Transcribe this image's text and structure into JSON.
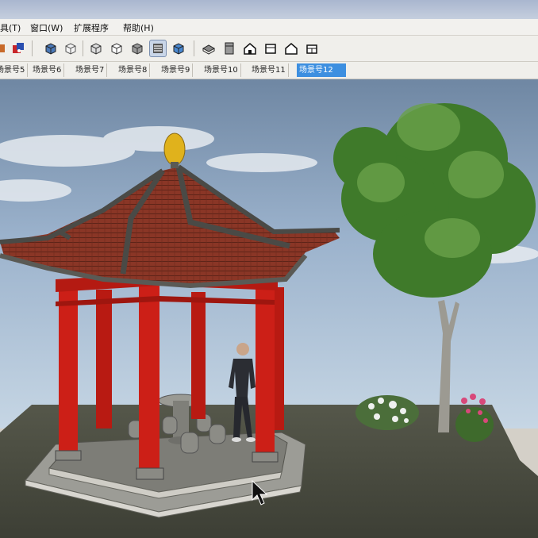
{
  "menus": [
    "具(T)",
    "窗口(W)",
    "扩展程序",
    "帮助(H)"
  ],
  "toolbar_icons": [
    "paint-bucket-icon",
    "component-icon",
    "cube-front-icon",
    "cube-outline-icon",
    "cube-textured-icon",
    "cube-shaded-icon",
    "cube-monochrome-icon",
    "xray-stack-icon",
    "cube-blue-icon",
    "iso-view-icon",
    "top-view-icon",
    "front-view-icon",
    "right-view-icon",
    "back-view-icon",
    "left-view-icon"
  ],
  "active_tool": "xray-stack-icon",
  "scene_tabs": [
    "场景号5",
    "场景号6",
    "场景号7",
    "场景号8",
    "场景号9",
    "场景号10",
    "场景号11",
    "场景号12"
  ],
  "active_scene": "场景号12",
  "colors": {
    "accent": "#3d8fe0",
    "pillar": "#cc1f17",
    "roof": "#8b3a2a",
    "sky": "#9fb6cf",
    "ground": "#4a4c40"
  }
}
